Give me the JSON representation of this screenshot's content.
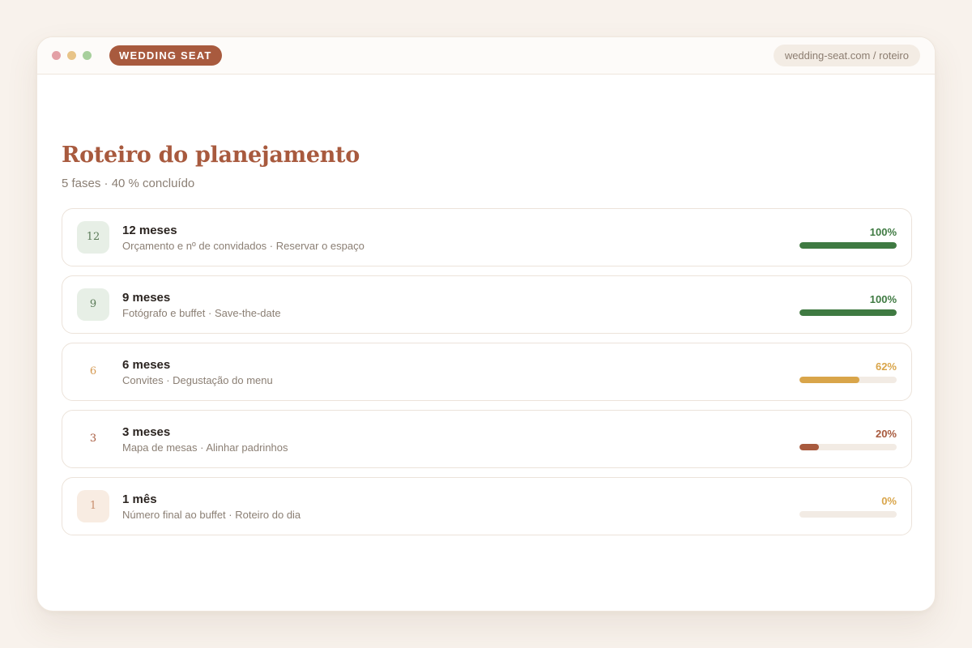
{
  "app": {
    "brand": "WEDDING SEAT",
    "url": "wedding-seat.com / roteiro"
  },
  "page": {
    "title": "Roteiro do planejamento",
    "subtitle": "5 fases · 40 % concluído"
  },
  "colors": {
    "done": "#3f7a42",
    "progress": "#d9a54a",
    "late": "#a85a3e",
    "todo": "#d9a54a"
  },
  "phases": [
    {
      "badge": "12",
      "name": "12 meses",
      "tasks": "Orçamento e nº de convidados · Reservar o espaço",
      "percent_label": "100%",
      "progress": 100,
      "status": "done"
    },
    {
      "badge": "9",
      "name": "9 meses",
      "tasks": "Fotógrafo e buffet · Save-the-date",
      "percent_label": "100%",
      "progress": 100,
      "status": "done"
    },
    {
      "badge": "6",
      "name": "6 meses",
      "tasks": "Convites · Degustação do menu",
      "percent_label": "62%",
      "progress": 62,
      "status": "progress"
    },
    {
      "badge": "3",
      "name": "3 meses",
      "tasks": "Mapa de mesas · Alinhar padrinhos",
      "percent_label": "20%",
      "progress": 20,
      "status": "late"
    },
    {
      "badge": "1",
      "name": "1 mês",
      "tasks": "Número final ao buffet · Roteiro do dia",
      "percent_label": "0%",
      "progress": 0,
      "status": "todo"
    }
  ]
}
